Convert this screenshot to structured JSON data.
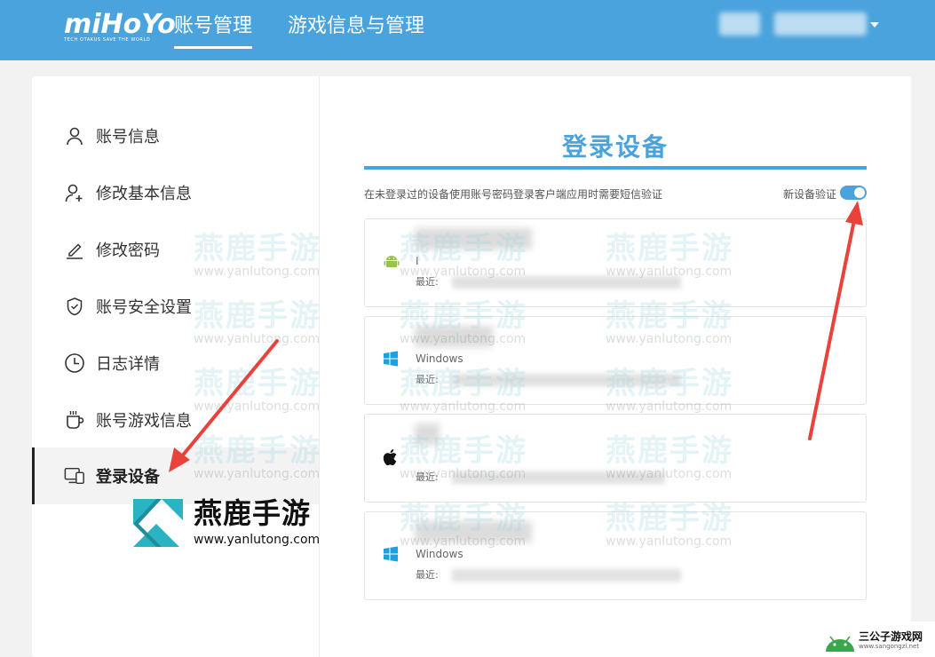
{
  "header": {
    "logo_text": "miHoYo",
    "logo_tagline": "TECH OTAKUS SAVE THE WORLD",
    "nav": [
      "账号管理",
      "游戏信息与管理"
    ]
  },
  "sidebar": {
    "items": [
      {
        "label": "账号信息",
        "icon": "user-icon"
      },
      {
        "label": "修改基本信息",
        "icon": "user-add-icon"
      },
      {
        "label": "修改密码",
        "icon": "pencil-icon"
      },
      {
        "label": "账号安全设置",
        "icon": "shield-check-icon"
      },
      {
        "label": "日志详情",
        "icon": "clock-icon"
      },
      {
        "label": "账号游戏信息",
        "icon": "cup-icon"
      },
      {
        "label": "登录设备",
        "icon": "devices-icon",
        "active": true
      }
    ]
  },
  "main": {
    "title": "登录设备",
    "description": "在未登录过的设备使用账号密码登录客户端应用时需要短信验证",
    "toggle_label": "新设备验证",
    "toggle_on": true,
    "recent_label": "最近:",
    "devices": [
      {
        "os": "android-icon",
        "os_name": "I"
      },
      {
        "os": "windows-icon",
        "os_name": "Windows"
      },
      {
        "os": "apple-icon",
        "os_name": ""
      },
      {
        "os": "windows-icon",
        "os_name": "Windows"
      }
    ]
  },
  "watermark": {
    "title": "燕鹿手游",
    "url": "www.yanlutong.com"
  },
  "corner_badge": {
    "title": "三公子游戏网",
    "url": "www.sangongzi.net"
  },
  "colors": {
    "accent": "#4aa3dc",
    "arrow": "#e8423b"
  }
}
